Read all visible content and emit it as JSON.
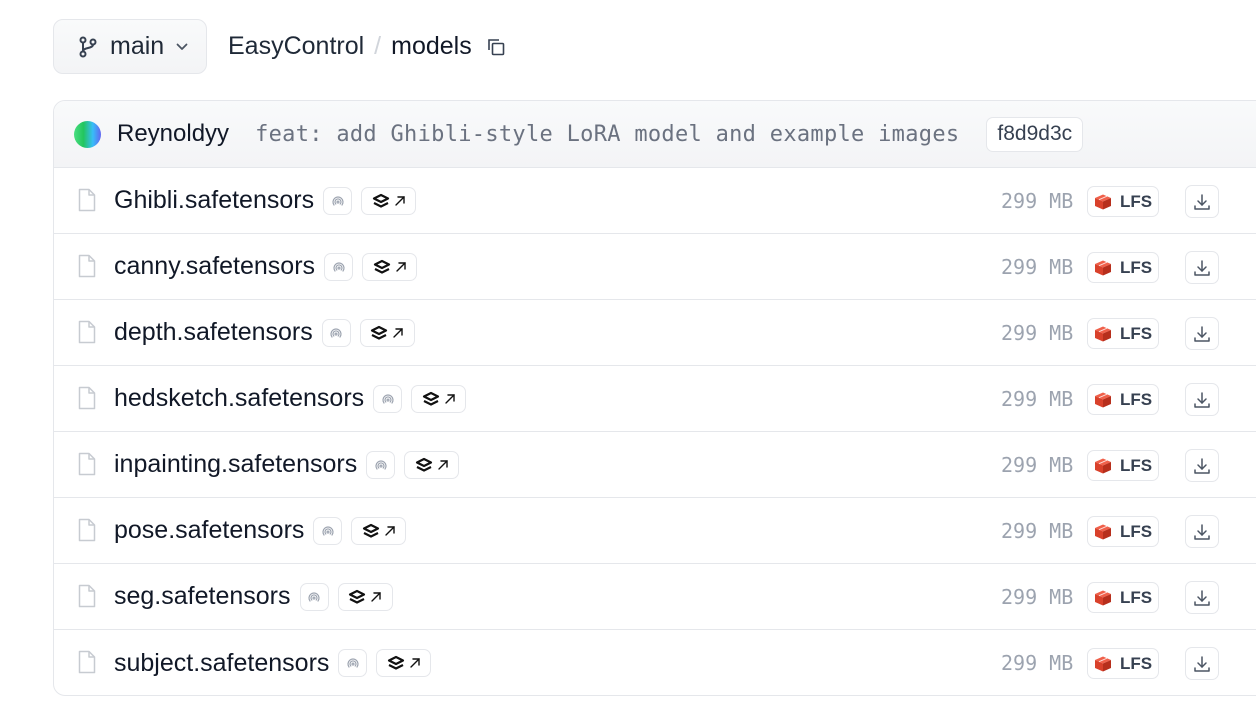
{
  "branch": {
    "label": "main"
  },
  "breadcrumb": {
    "repo": "EasyControl",
    "separator": "/",
    "folder": "models"
  },
  "commit": {
    "author": "Reynoldyy",
    "message": "feat: add Ghibli-style LoRA model and example images",
    "sha": "f8d9d3c"
  },
  "files": [
    {
      "name": "Ghibli.safetensors",
      "size": "299 MB",
      "lfs": "LFS"
    },
    {
      "name": "canny.safetensors",
      "size": "299 MB",
      "lfs": "LFS"
    },
    {
      "name": "depth.safetensors",
      "size": "299 MB",
      "lfs": "LFS"
    },
    {
      "name": "hedsketch.safetensors",
      "size": "299 MB",
      "lfs": "LFS"
    },
    {
      "name": "inpainting.safetensors",
      "size": "299 MB",
      "lfs": "LFS"
    },
    {
      "name": "pose.safetensors",
      "size": "299 MB",
      "lfs": "LFS"
    },
    {
      "name": "seg.safetensors",
      "size": "299 MB",
      "lfs": "LFS"
    },
    {
      "name": "subject.safetensors",
      "size": "299 MB",
      "lfs": "LFS"
    }
  ],
  "icons": {
    "branch": "git-branch-icon",
    "chevron": "chevron-down-icon",
    "copy": "copy-icon",
    "file": "file-icon",
    "scan": "security-scan-icon",
    "open": "stack-external-link-icon",
    "lfs": "lfs-icon",
    "download": "download-icon"
  },
  "colors": {
    "lfs_red": "#e0472f",
    "muted": "#9ca3af"
  }
}
